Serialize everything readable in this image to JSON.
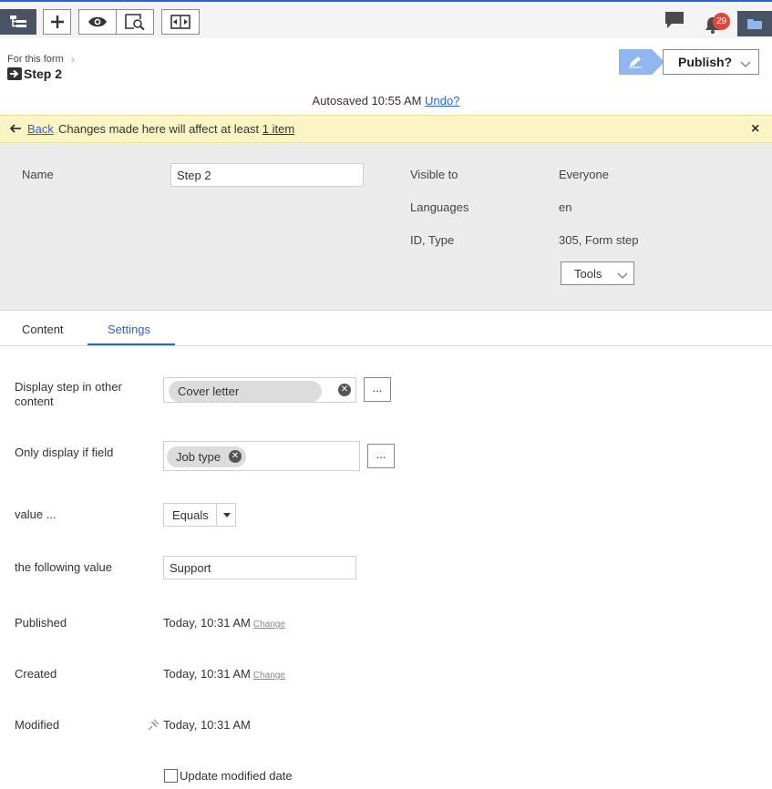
{
  "toolbar": {
    "icons": [
      "tree-icon",
      "plus-icon",
      "eye-icon",
      "preview-search-icon",
      "compare-icon"
    ],
    "notifications_count": "29",
    "right_icons": [
      "comment-icon",
      "bell-icon",
      "folder-icon"
    ]
  },
  "breadcrumb": {
    "parent": "For this form",
    "title": "Step 2"
  },
  "publish": {
    "label": "Publish?"
  },
  "autosave": {
    "text": "Autosaved 10:55 AM",
    "undo": "Undo?"
  },
  "notice": {
    "back": "Back",
    "message": "Changes made here will affect at least",
    "link": "1 item",
    "close": "×"
  },
  "properties": {
    "name_label": "Name",
    "name_value": "Step 2",
    "visible_label": "Visible to",
    "visible_value": "Everyone",
    "languages_label": "Languages",
    "languages_value": "en",
    "id_label": "ID, Type",
    "id_value": "305, Form step",
    "tools_label": "Tools"
  },
  "tabs": {
    "content": "Content",
    "settings": "Settings"
  },
  "settings": {
    "display_step_label": "Display step in other content",
    "display_step_chip": "Cover letter",
    "only_display_label": "Only display if field",
    "only_display_chip": "Job type",
    "dots": "...",
    "value_label": "value ...",
    "operator_value": "Equals",
    "following_label": "the following value",
    "following_value": "Support",
    "published_label": "Published",
    "published_value": "Today, 10:31 AM",
    "created_label": "Created",
    "created_value": "Today, 10:31 AM",
    "change_link": "Change",
    "modified_label": "Modified",
    "modified_value": "Today, 10:31 AM",
    "update_modified_label": "Update modified date"
  },
  "colors": {
    "accent": "#2a62d8",
    "notice_bg": "#fbf5c6",
    "panel_bg": "#ececec",
    "badge": "#e0473c",
    "edit_button": "#8fb6ee"
  }
}
